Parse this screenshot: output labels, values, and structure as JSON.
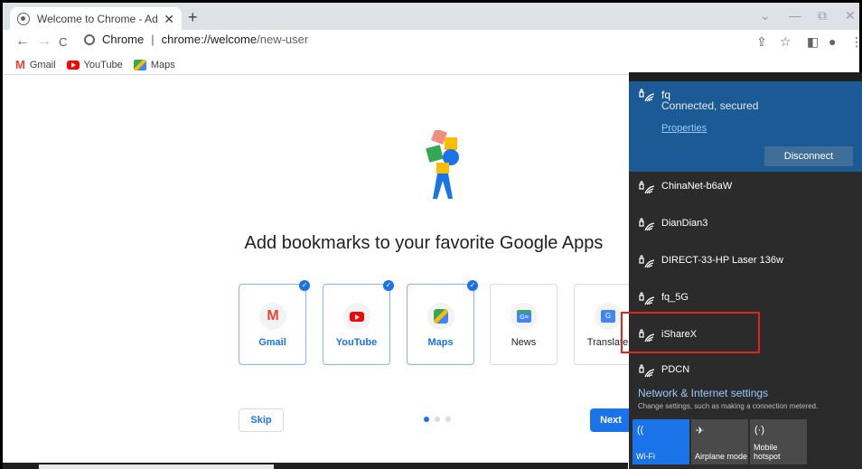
{
  "tab": {
    "title": "Welcome to Chrome - Add book",
    "close": "✕"
  },
  "newtab": "+",
  "window_controls": {
    "chevron": "⌄",
    "minimize": "—",
    "restore": "⧉",
    "close": "✕"
  },
  "toolbar": {
    "back": "←",
    "forward": "→",
    "reload": "C",
    "origin": "Chrome",
    "separator": "|",
    "url_host": "chrome://welcome",
    "url_path": "/new-user",
    "share": "⇪",
    "star": "☆",
    "sidepanel": "◧",
    "profile": "●",
    "menu": "⋮"
  },
  "bookmarks": [
    {
      "label": "Gmail",
      "icon": "gmail-icon"
    },
    {
      "label": "YouTube",
      "icon": "youtube-icon"
    },
    {
      "label": "Maps",
      "icon": "maps-icon"
    }
  ],
  "page": {
    "headline": "Add bookmarks to your favorite Google Apps",
    "apps": [
      {
        "label": "Gmail",
        "selected": true
      },
      {
        "label": "YouTube",
        "selected": true
      },
      {
        "label": "Maps",
        "selected": true
      },
      {
        "label": "News",
        "selected": false
      },
      {
        "label": "Translate",
        "selected": false
      }
    ],
    "skip": "Skip",
    "next": "Next",
    "check": "✓"
  },
  "wifi": {
    "connected": {
      "name": "fq",
      "status": "Connected, secured",
      "properties": "Properties",
      "disconnect": "Disconnect"
    },
    "networks": [
      "ChinaNet-b6aW",
      "DianDian3",
      "DIRECT-33-HP Laser 136w",
      "fq_5G",
      "iShareX",
      "PDCN"
    ],
    "settings_title": "Network & Internet settings",
    "settings_sub": "Change settings, such as making a connection metered.",
    "quick_actions": [
      {
        "label": "Wi-Fi",
        "icon": "((",
        "active": true
      },
      {
        "label": "Airplane mode",
        "icon": "✈",
        "active": false
      },
      {
        "label": "Mobile hotspot",
        "icon": "(·)",
        "active": false
      }
    ]
  },
  "colors": {
    "accent": "#1a73e8",
    "wifi_connected": "#1b5a94",
    "flyout_bg": "#2b2b2b",
    "highlight": "#e0241a"
  }
}
